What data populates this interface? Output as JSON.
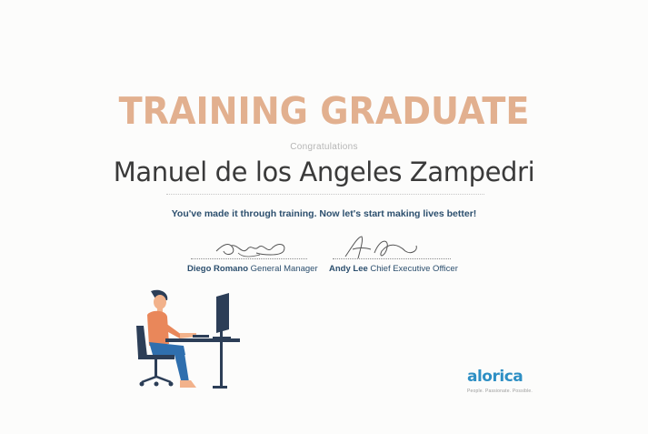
{
  "certificate": {
    "title": "TRAINING GRADUATE",
    "congratulations": "Congratulations",
    "recipient_name": "Manuel de los Angeles Zampedri",
    "tagline": "You've made it through training. Now let's start making lives better!",
    "signatories": [
      {
        "name": "Diego Romano",
        "role": "General Manager"
      },
      {
        "name": "Andy Lee",
        "role": "Chief Executive Officer"
      }
    ],
    "brand": {
      "logo_text": "alorica",
      "slogan": "People. Passionate. Possible."
    },
    "colors": {
      "title": "#e2b08f",
      "text_navy": "#2c4f6e",
      "brand_blue": "#2e8fc4"
    }
  }
}
